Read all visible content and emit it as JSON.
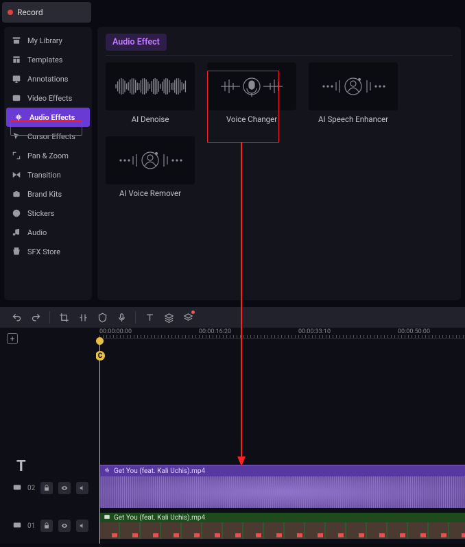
{
  "record": {
    "label": "Record"
  },
  "sidebar": {
    "items": [
      {
        "label": "My Library",
        "icon": "archive-icon",
        "active": false
      },
      {
        "label": "Templates",
        "icon": "templates-icon",
        "active": false
      },
      {
        "label": "Annotations",
        "icon": "annotations-icon",
        "active": false
      },
      {
        "label": "Video Effects",
        "icon": "video-effects-icon",
        "active": false
      },
      {
        "label": "Audio Effects",
        "icon": "audio-effects-icon",
        "active": true
      },
      {
        "label": "Cursor Effects",
        "icon": "cursor-effects-icon",
        "active": false
      },
      {
        "label": "Pan & Zoom",
        "icon": "pan-zoom-icon",
        "active": false
      },
      {
        "label": "Transition",
        "icon": "transition-icon",
        "active": false
      },
      {
        "label": "Brand Kits",
        "icon": "brand-kits-icon",
        "active": false
      },
      {
        "label": "Stickers",
        "icon": "stickers-icon",
        "active": false
      },
      {
        "label": "Audio",
        "icon": "audio-icon",
        "active": false
      },
      {
        "label": "SFX Store",
        "icon": "sfx-store-icon",
        "active": false
      }
    ]
  },
  "content": {
    "section_title": "Audio Effect",
    "effects": [
      {
        "label": "AI Denoise"
      },
      {
        "label": "Voice Changer"
      },
      {
        "label": "AI Speech Enhancer"
      },
      {
        "label": "AI Voice Remover"
      }
    ]
  },
  "toolbar": {
    "items": [
      "undo-icon",
      "redo-icon",
      "sep",
      "crop-icon",
      "split-icon",
      "shield-icon",
      "mic-icon",
      "sep",
      "text-icon",
      "layers-icon",
      "layers-dot-icon"
    ]
  },
  "timeline": {
    "ruler": [
      "00:00:00:00",
      "00:00:16:20",
      "00:00:33:10",
      "00:00:50:00"
    ],
    "audio_track": {
      "file": "Get You (feat. Kali Uchis).mp4"
    },
    "video_track": {
      "file": "Get You (feat. Kali Uchis).mp4"
    },
    "track_rows": [
      {
        "num": "02"
      },
      {
        "num": "01"
      }
    ],
    "playhead_badge": "C"
  },
  "highlight_color": "#ff2020"
}
